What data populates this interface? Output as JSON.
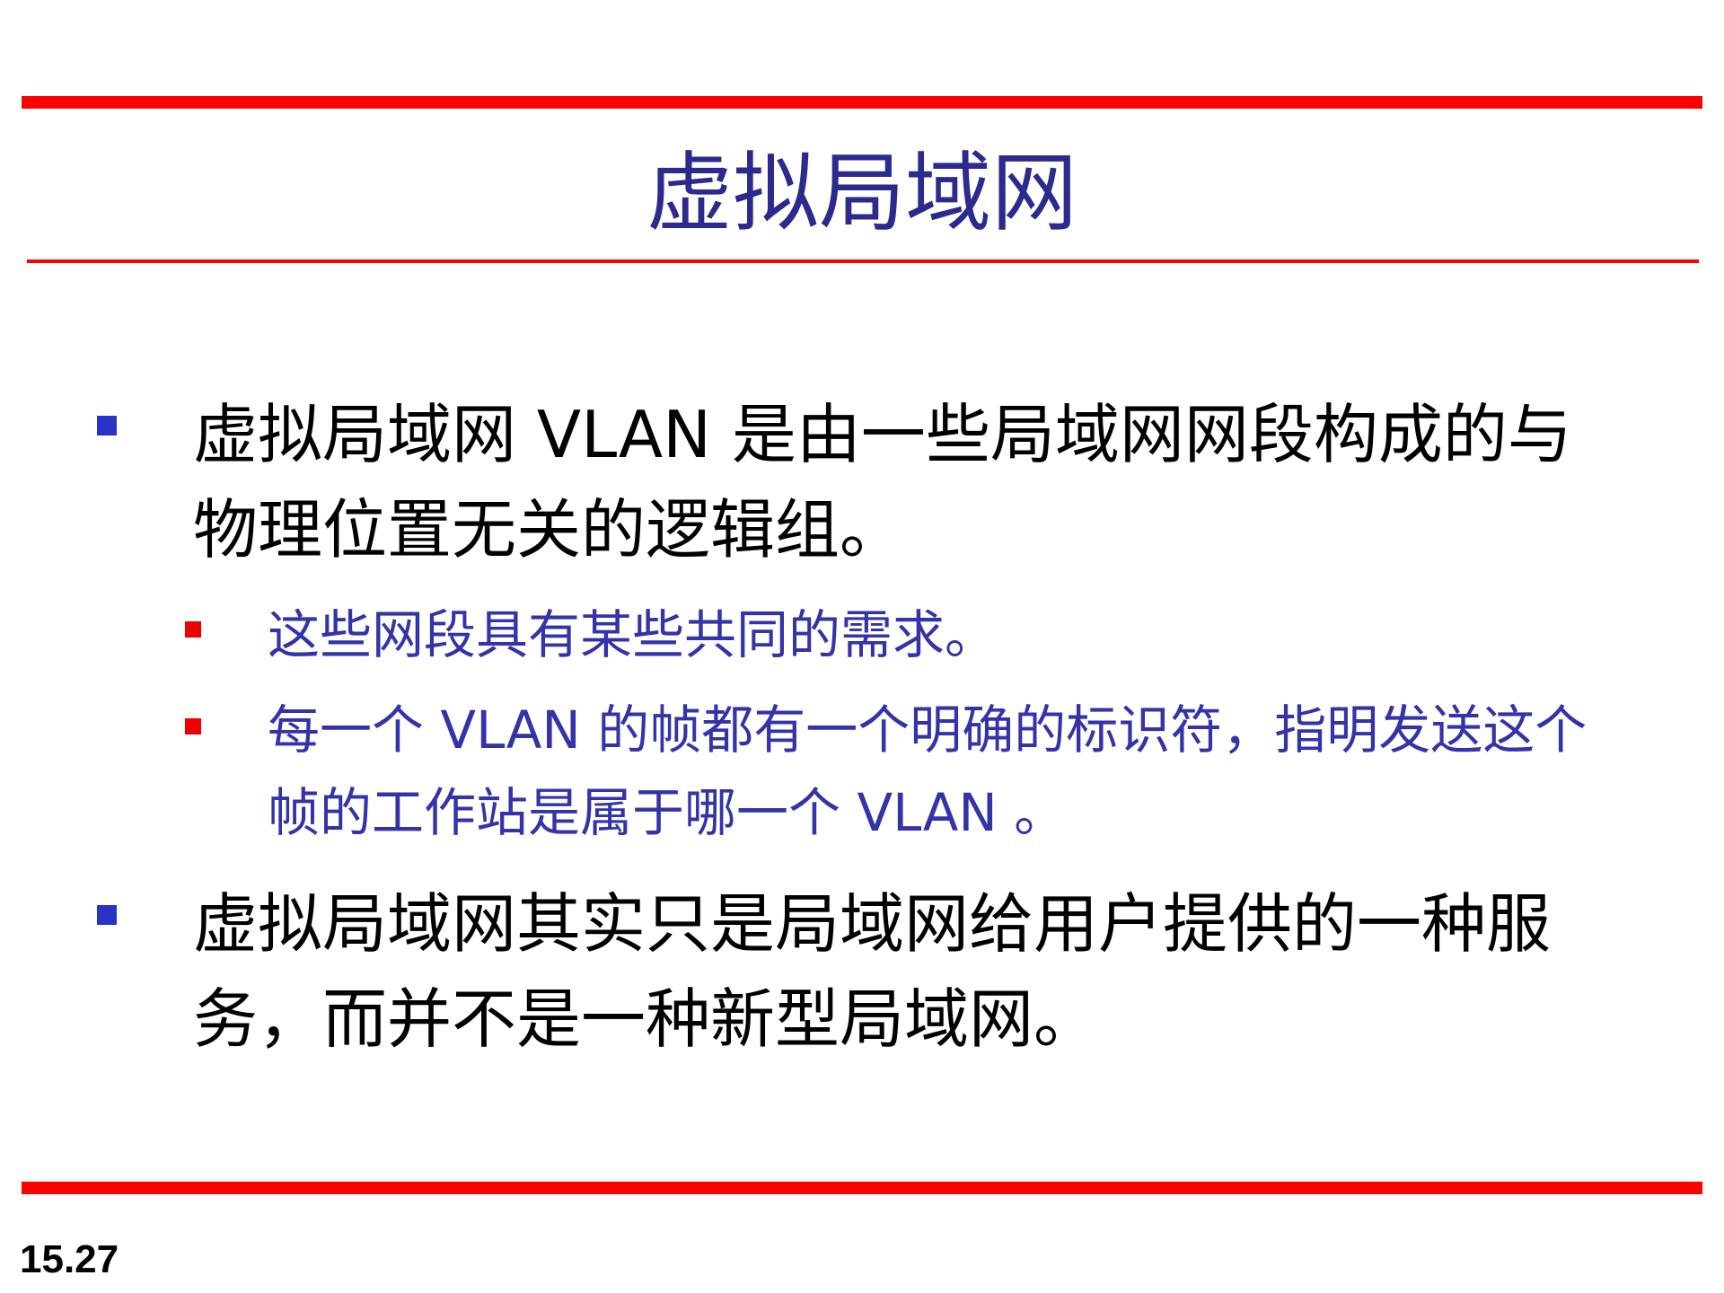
{
  "slide": {
    "title": "虚拟局域网",
    "bullets": [
      {
        "text": "虚拟局域网 VLAN 是由一些局域网网段构成的与物理位置无关的逻辑组。"
      },
      {
        "text": "这些网段具有某些共同的需求。"
      },
      {
        "text": "每一个 VLAN 的帧都有一个明确的标识符，指明发送这个帧的工作站是属于哪一个 VLAN 。"
      },
      {
        "text": "虚拟局域网其实只是局域网给用户提供的一种服务，而并不是一种新型局域网。"
      }
    ],
    "page_number": "15.27"
  },
  "colors": {
    "rule": "#ff0000",
    "title": "#2b2b8f",
    "main_bullet": "#2a33c7",
    "sub_bullet": "#ee0000",
    "sub_text": "#3333aa",
    "main_text": "#000000"
  }
}
